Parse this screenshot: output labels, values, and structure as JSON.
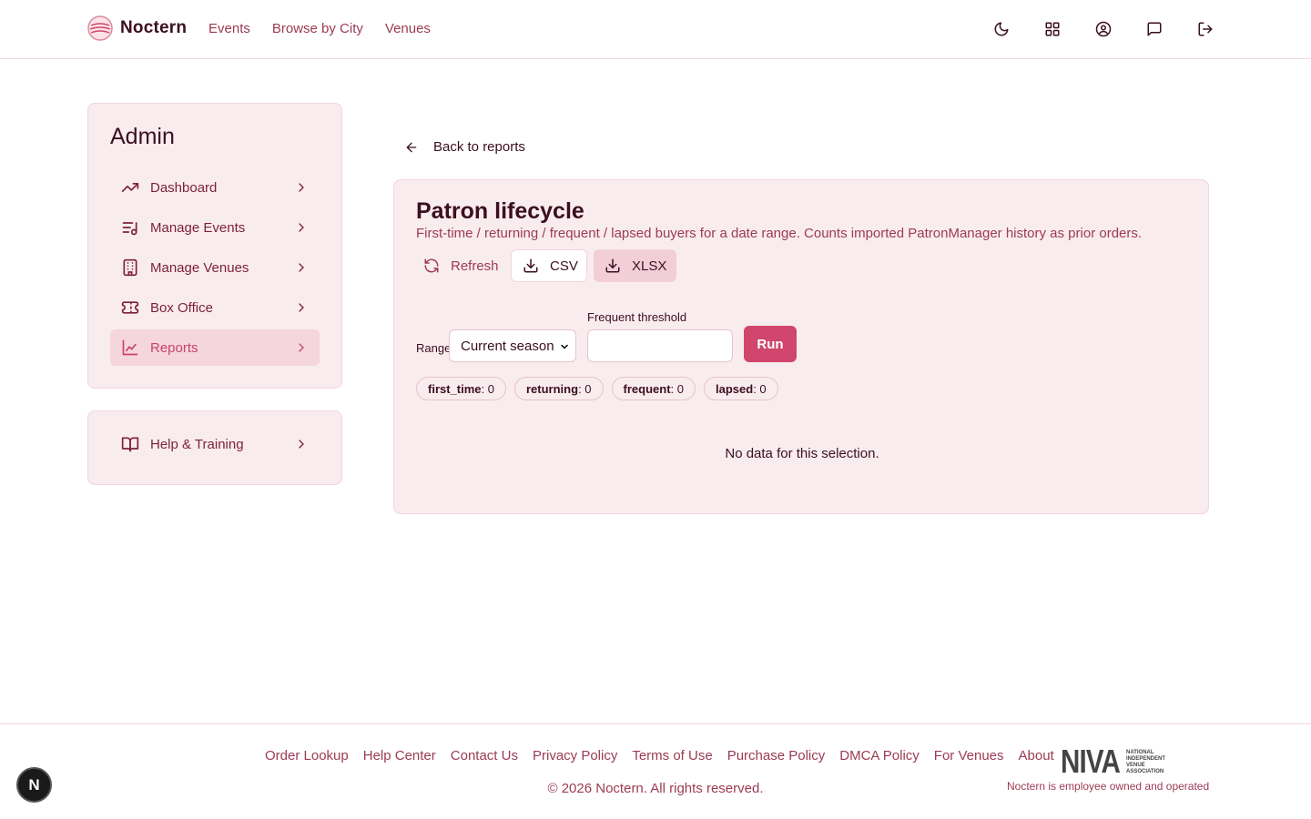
{
  "app": {
    "name": "Noctern"
  },
  "nav": {
    "items": [
      {
        "label": "Events"
      },
      {
        "label": "Browse by City"
      },
      {
        "label": "Venues"
      }
    ]
  },
  "header_icons": [
    "moon-icon",
    "grid-icon",
    "user-circle-icon",
    "message-icon",
    "logout-icon"
  ],
  "sidebar": {
    "title": "Admin",
    "items": [
      {
        "label": "Dashboard",
        "icon": "trending-up-icon",
        "active": false
      },
      {
        "label": "Manage Events",
        "icon": "list-music-icon",
        "active": false
      },
      {
        "label": "Manage Venues",
        "icon": "building-icon",
        "active": false
      },
      {
        "label": "Box Office",
        "icon": "ticket-icon",
        "active": false
      },
      {
        "label": "Reports",
        "icon": "line-chart-icon",
        "active": true
      }
    ],
    "help": {
      "label": "Help & Training",
      "icon": "book-open-icon"
    }
  },
  "main": {
    "back_label": "Back to reports",
    "title": "Patron lifecycle",
    "description": "First-time / returning / frequent / lapsed buyers for a date range. Counts imported PatronManager history as prior orders.",
    "actions": {
      "refresh": "Refresh",
      "csv": "CSV",
      "xlsx": "XLSX"
    },
    "form": {
      "range_label": "Range",
      "range_value": "Current season",
      "frequent_label": "Frequent threshold",
      "frequent_value": "",
      "run_label": "Run"
    },
    "chips": [
      {
        "key": "first_time",
        "value": ": 0"
      },
      {
        "key": "returning",
        "value": ": 0"
      },
      {
        "key": "frequent",
        "value": ": 0"
      },
      {
        "key": "lapsed",
        "value": ": 0"
      }
    ],
    "empty_message": "No data for this selection."
  },
  "footer": {
    "links": [
      {
        "label": "Order Lookup"
      },
      {
        "label": "Help Center"
      },
      {
        "label": "Contact Us"
      },
      {
        "label": "Privacy Policy"
      },
      {
        "label": "Terms of Use"
      },
      {
        "label": "Purchase Policy"
      },
      {
        "label": "DMCA Policy"
      },
      {
        "label": "For Venues"
      },
      {
        "label": "About"
      }
    ],
    "copyright": "© 2026 Noctern. All rights reserved.",
    "niva_big": "NIVA",
    "niva_small": "NATIONAL INDEPENDENT VENUE ASSOCIATION",
    "employee_note": "Noctern is employee owned and operated"
  },
  "dev_badge": "N",
  "colors": {
    "accent": "#d0466d",
    "panel_bg": "#f9ecef",
    "link": "#9c3a55",
    "text": "#3b0f1f"
  }
}
